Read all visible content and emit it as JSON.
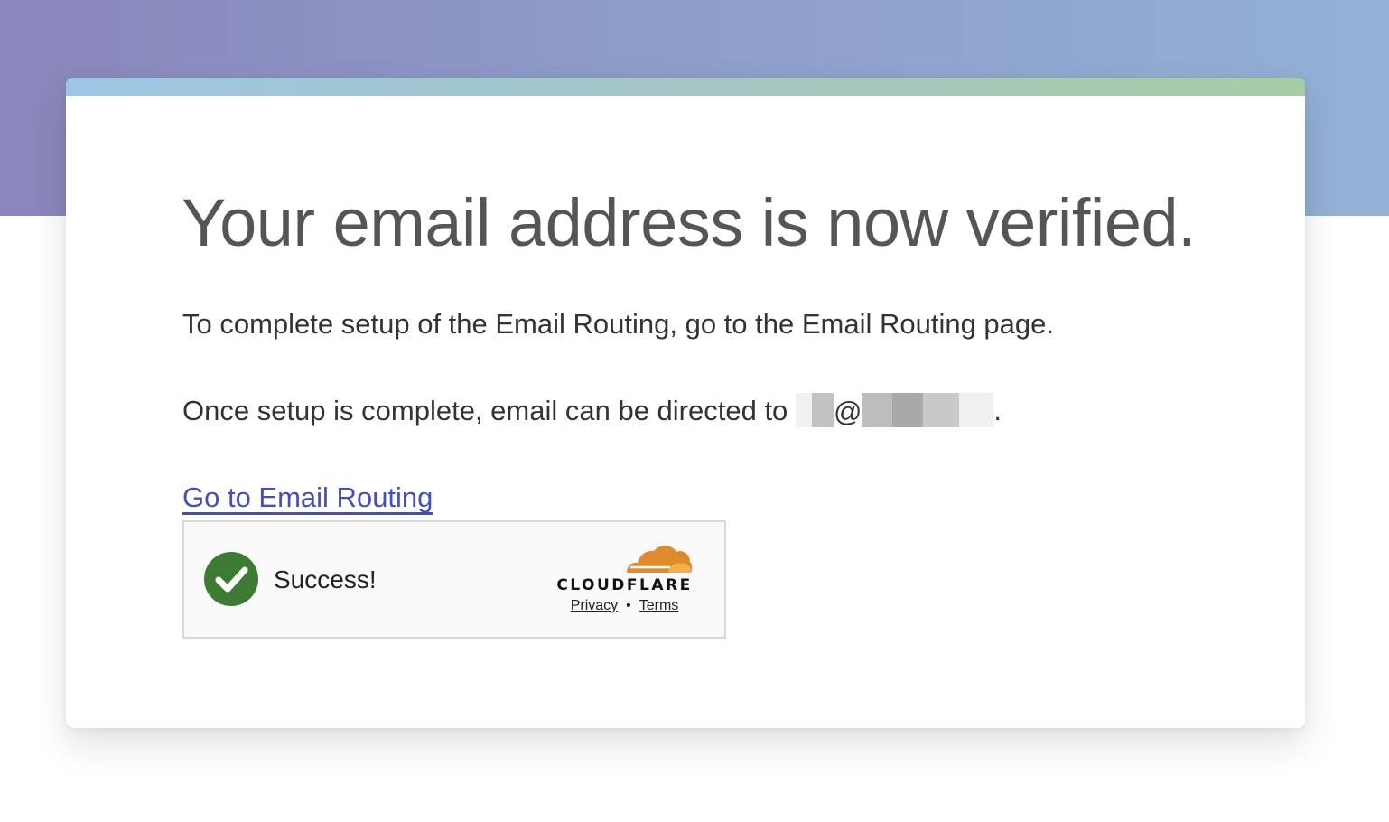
{
  "page": {
    "title": "Your email address is now verified.",
    "setup_text": "To complete setup of the Email Routing, go to the Email Routing page.",
    "directed_prefix": "Once setup is complete, email can be directed to",
    "at_sign": "@",
    "trailing_period": ".",
    "link_label": "Go to Email Routing"
  },
  "captcha": {
    "status": "Success!",
    "brand": "CLOUDFLARE",
    "privacy_label": "Privacy",
    "separator": "•",
    "terms_label": "Terms",
    "icon": "check-circle-icon",
    "logo_icon": "cloudflare-cloud-icon"
  },
  "colors": {
    "link": "#4650b4",
    "success_green": "#3d7a34",
    "cloudflare_orange": "#e08a2e",
    "header_gradient_start": "#8a85bb",
    "header_gradient_end": "#93b1d7"
  }
}
